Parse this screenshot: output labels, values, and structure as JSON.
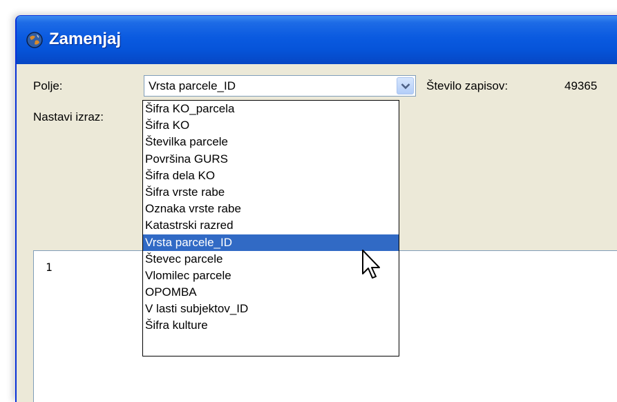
{
  "window": {
    "title": "Zamenjaj"
  },
  "form": {
    "polje_label": "Polje:",
    "polje_value": "Vrsta parcele_ID",
    "stevilo_label": "Število zapisov:",
    "stevilo_value": "49365",
    "izraz_label": "Nastavi izraz:"
  },
  "editor": {
    "line_number": "1"
  },
  "dropdown": {
    "selected_index": 8,
    "items": [
      "Šifra KO_parcela",
      "Šifra KO",
      "Številka parcele",
      "Površina GURS",
      "Šifra dela KO",
      "Šifra vrste rabe",
      "Oznaka vrste rabe",
      "Katastrski razred",
      "Vrsta parcele_ID",
      "Števec parcele",
      "Vlomilec parcele",
      "OPOMBA",
      "V lasti subjektov_ID",
      "Šifra kulture"
    ]
  },
  "colors": {
    "title_bar": "#0a5ae0",
    "selection": "#316ac5",
    "dialog_bg": "#ece9d8"
  },
  "icons": {
    "title": "globe-icon",
    "combo_button": "chevron-down-icon",
    "pointer": "mouse-cursor-icon"
  }
}
